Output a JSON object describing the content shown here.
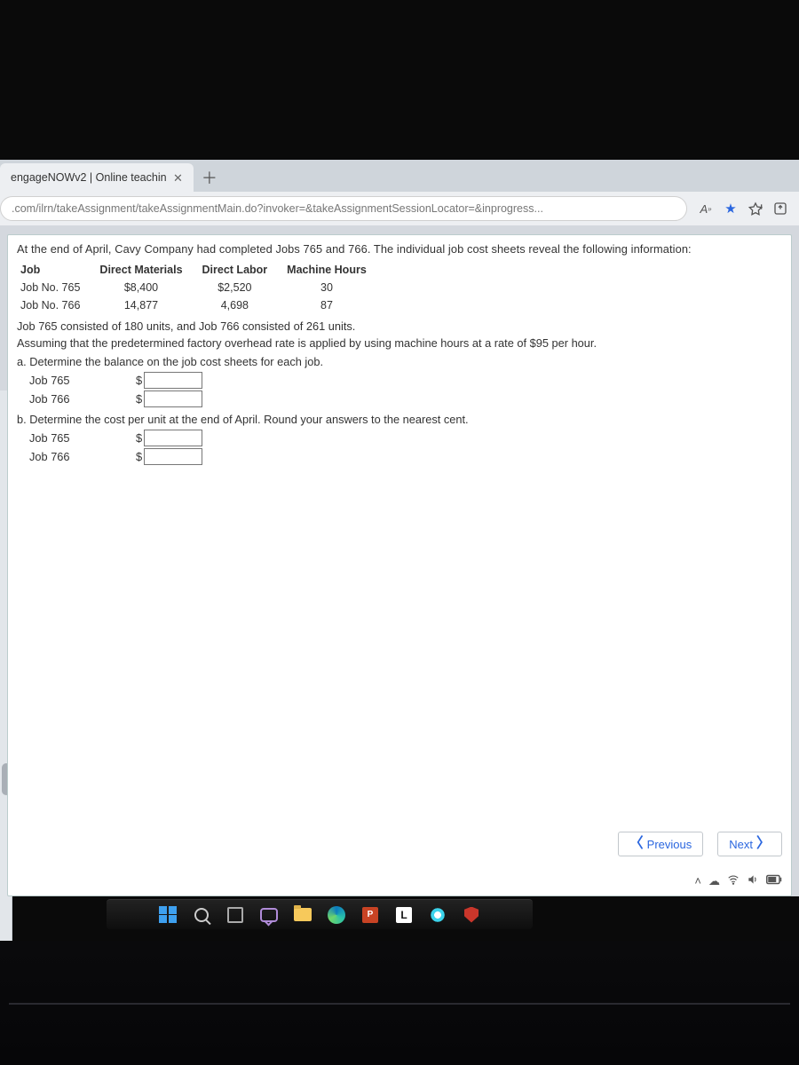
{
  "browser": {
    "tab_title": "engageNOWv2 | Online teachin",
    "url": ".com/ilrn/takeAssignment/takeAssignmentMain.do?invoker=&takeAssignmentSessionLocator=&inprogress...",
    "reader_label": "A"
  },
  "intro_text": "At the end of April, Cavy Company had completed Jobs 765 and 766. The individual job cost sheets reveal the following information:",
  "table": {
    "headers": [
      "Job",
      "Direct Materials",
      "Direct Labor",
      "Machine Hours"
    ],
    "rows": [
      {
        "job": "Job No. 765",
        "dm": "$8,400",
        "dl": "$2,520",
        "mh": "30"
      },
      {
        "job": "Job No. 766",
        "dm": "14,877",
        "dl": "4,698",
        "mh": "87"
      }
    ]
  },
  "units_text": "Job 765 consisted of 180 units, and Job 766 consisted of 261 units.",
  "assume_text": "Assuming that the predetermined factory overhead rate is applied by using machine hours at a rate of $95 per hour.",
  "qa": {
    "a_prompt": "a.  Determine the balance on the job cost sheets for each job.",
    "b_prompt": "b.  Determine the cost per unit at the end of April. Round your answers to the nearest cent.",
    "job765": "Job 765",
    "job766": "Job 766",
    "currency": "$"
  },
  "nav": {
    "prev": "Previous",
    "next": "Next"
  },
  "chart_data": {
    "type": "table",
    "title": "Job cost sheet data",
    "columns": [
      "Job",
      "Direct Materials",
      "Direct Labor",
      "Machine Hours"
    ],
    "rows": [
      [
        "Job No. 765",
        8400,
        2520,
        30
      ],
      [
        "Job No. 766",
        14877,
        4698,
        87
      ]
    ],
    "notes": {
      "units": {
        "Job 765": 180,
        "Job 766": 261
      },
      "overhead_rate_per_machine_hour": 95
    }
  }
}
